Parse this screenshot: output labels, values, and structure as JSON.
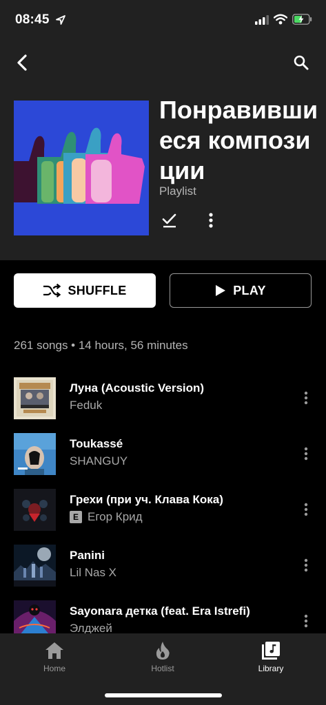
{
  "status": {
    "time": "08:45"
  },
  "header": {
    "title": "Понравившиеся композиции",
    "subtitle": "Playlist"
  },
  "actions": {
    "shuffle_label": "SHUFFLE",
    "play_label": "PLAY"
  },
  "summary": "261 songs • 14 hours, 56 minutes",
  "songs": [
    {
      "title": "Луна (Acoustic Version)",
      "artist": "Feduk",
      "explicit": false
    },
    {
      "title": "Toukassé",
      "artist": "SHANGUY",
      "explicit": false
    },
    {
      "title": "Грехи (при уч. Клава Кока)",
      "artist": "Егор Крид",
      "explicit": true,
      "explicit_badge": "E"
    },
    {
      "title": "Panini",
      "artist": "Lil Nas X",
      "explicit": false
    },
    {
      "title": "Sayonara детка (feat. Era Istrefi)",
      "artist": "Элджей",
      "explicit": false
    }
  ],
  "nav": [
    {
      "label": "Home",
      "icon": "home-icon",
      "active": false
    },
    {
      "label": "Hotlist",
      "icon": "flame-icon",
      "active": false
    },
    {
      "label": "Library",
      "icon": "library-icon",
      "active": true
    }
  ],
  "colors": {
    "background": "#000000",
    "header_bg": "#212121",
    "cover_blue": "#2c48d7"
  }
}
